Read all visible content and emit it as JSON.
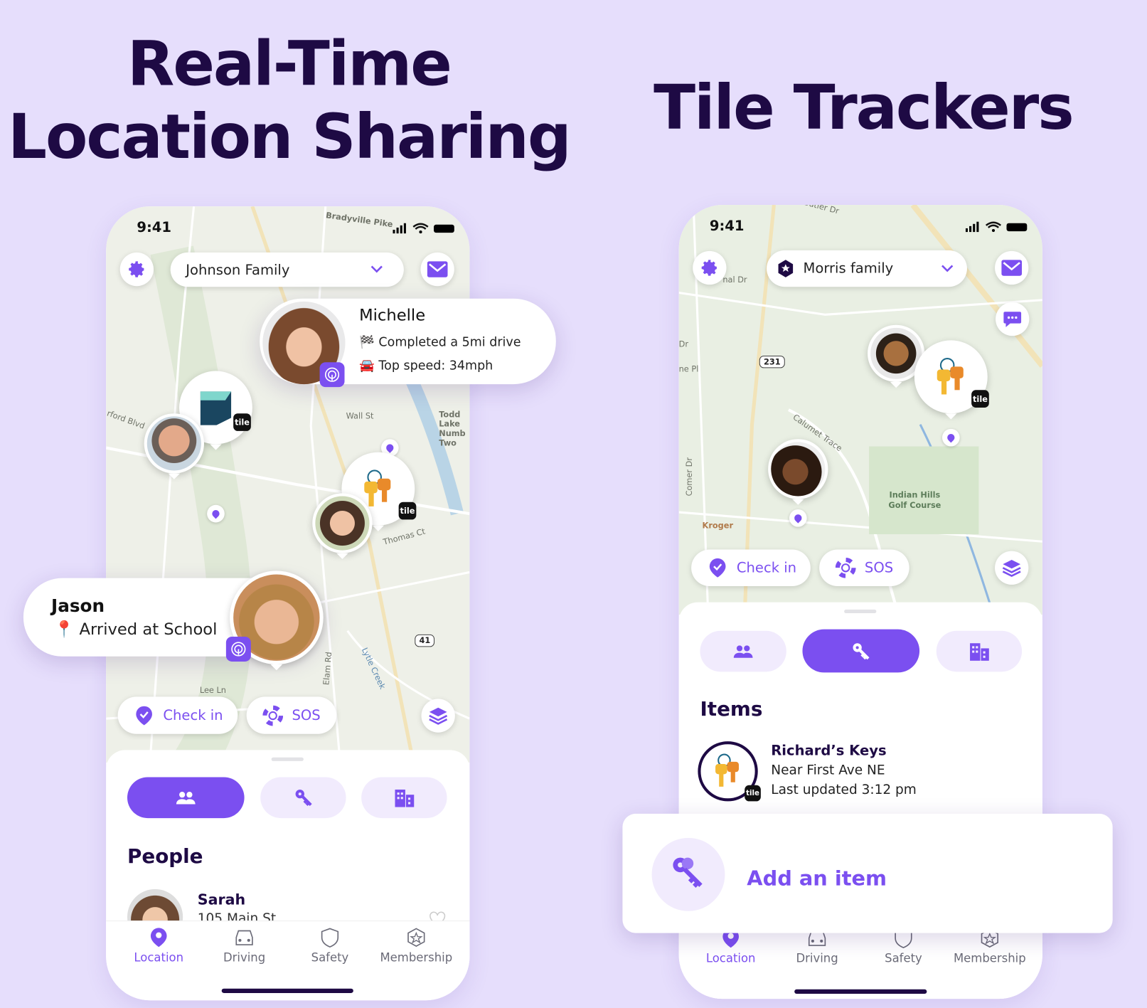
{
  "headlines": {
    "left_line1": "Real-Time",
    "left_line2": "Location Sharing",
    "right": "Tile Trackers"
  },
  "colors": {
    "accent": "#7b4ff0",
    "accent_light": "#f1ebfd",
    "headline": "#1e0a44",
    "background": "#e6defc"
  },
  "left_phone": {
    "status_time": "9:41",
    "circle_name": "Johnson Family",
    "map_labels": [
      "Bradyville Pike",
      "Wall St",
      "Todd Lake Numb Two",
      "rford Blvd",
      "Thomas Ct",
      "41",
      "Elam Rd",
      "Lytle Creek",
      "Lee Ln"
    ],
    "michelle_card": {
      "name": "Michelle",
      "line1": "🏁 Completed a 5mi drive",
      "line2": "🚘 Top speed: 34mph"
    },
    "jason_card": {
      "name": "Jason",
      "line1": "📍 Arrived at School"
    },
    "check_in": "Check in",
    "sos": "SOS",
    "section_title": "People",
    "person": {
      "name": "Sarah",
      "address": "105 Main St"
    },
    "tabs": [
      "Location",
      "Driving",
      "Safety",
      "Membership"
    ],
    "active_segment": "people"
  },
  "right_phone": {
    "status_time": "9:41",
    "circle_name": "Morris family",
    "map_labels": [
      "Butler Dr",
      "nal Dr",
      "Dr",
      "ne Pl",
      "231",
      "Calumet Trace",
      "Comer Dr",
      "Indian Hills Golf Course",
      "Kroger"
    ],
    "check_in": "Check in",
    "sos": "SOS",
    "section_title": "Items",
    "item": {
      "name": "Richard’s Keys",
      "location": "Near First Ave NE",
      "updated": "Last updated 3:12 pm"
    },
    "add_item": "Add an item",
    "tabs": [
      "Location",
      "Driving",
      "Safety",
      "Membership"
    ],
    "active_segment": "items"
  },
  "icons": {
    "tile_badge": "tile"
  }
}
